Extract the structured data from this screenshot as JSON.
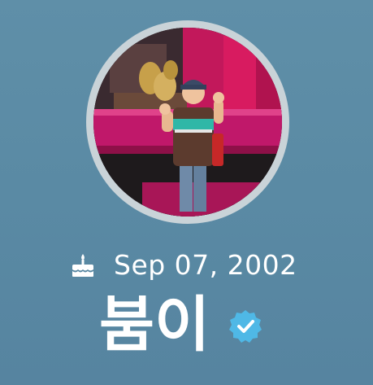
{
  "profile": {
    "birth_date": "Sep 07, 2002",
    "display_name": "붐이",
    "birthday_icon": "birthday-cake-icon",
    "verified_icon": "verified-badge-icon",
    "avatar": "profile-photo",
    "colors": {
      "background": "#5a8aa4",
      "ring": "#c9d3d8",
      "verified": "#4fb8e6",
      "text": "#ffffff"
    }
  }
}
